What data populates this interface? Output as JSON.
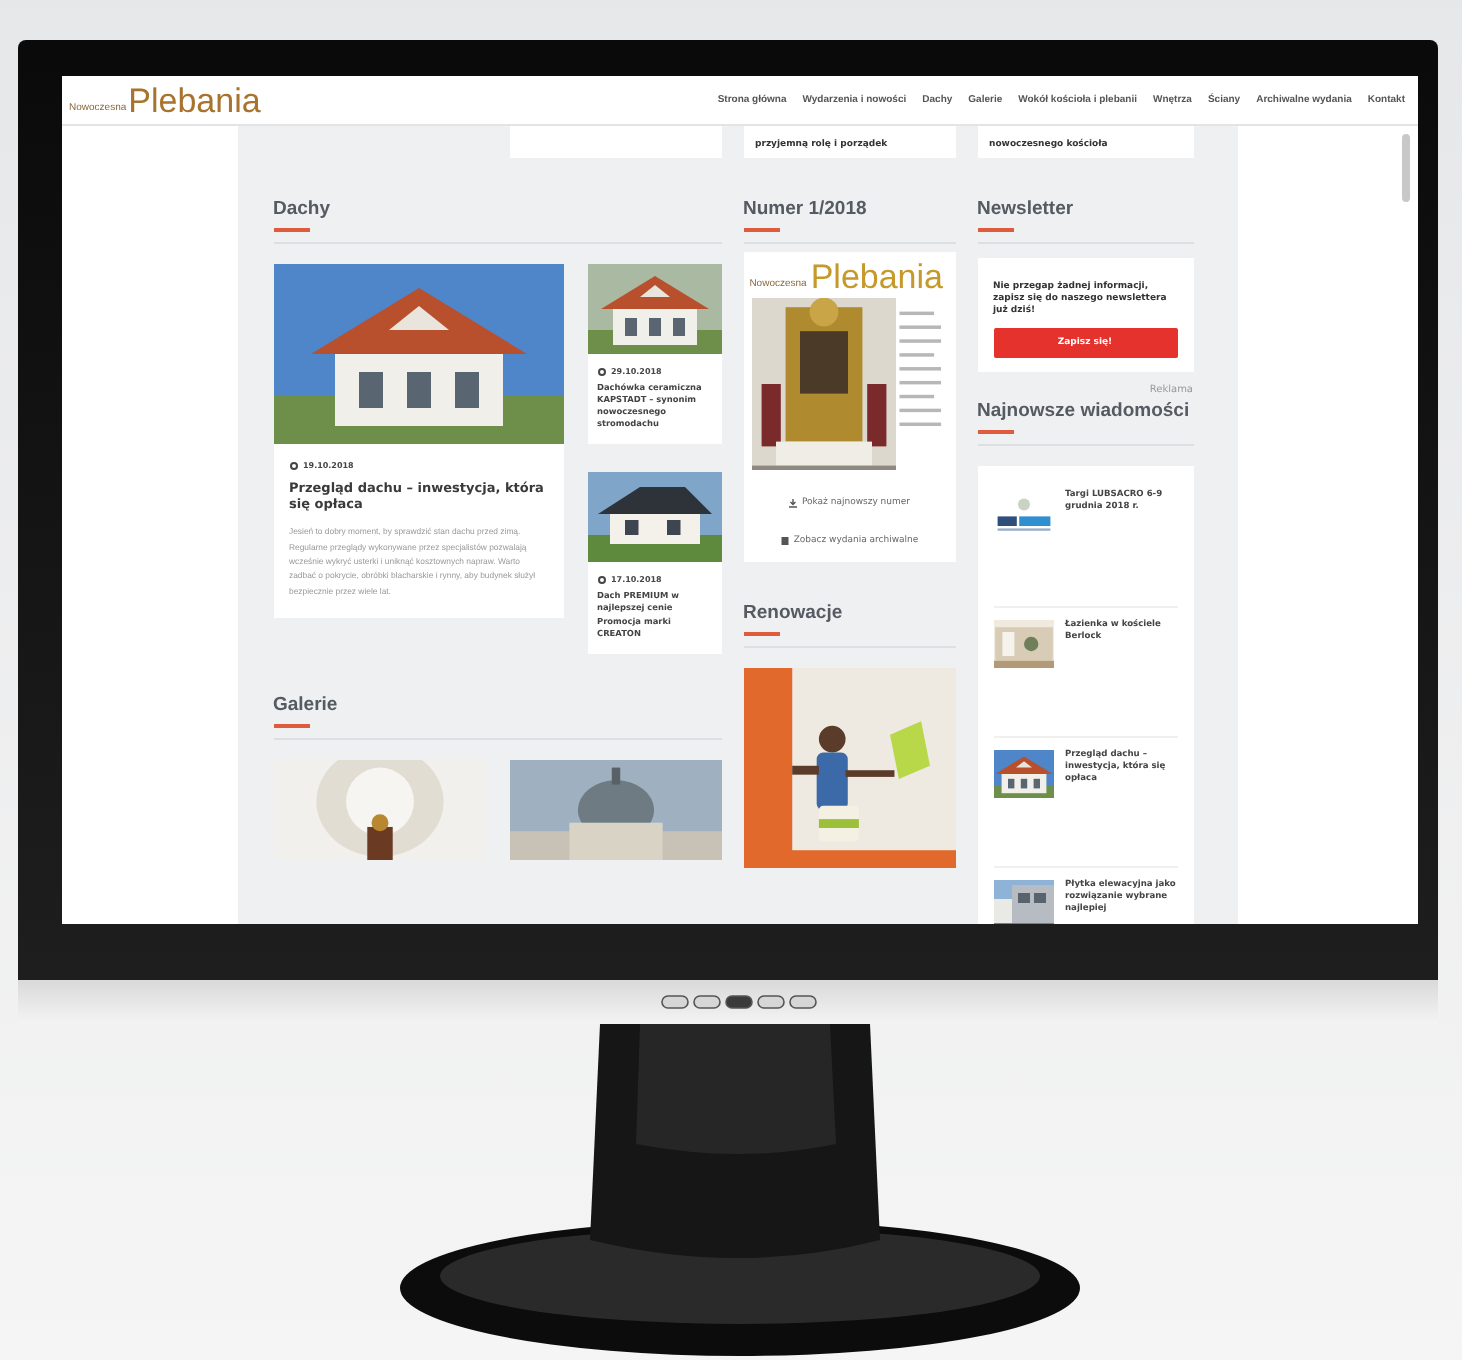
{
  "header": {
    "logo_tagline": "Nowoczesna",
    "logo": "Plebania"
  },
  "nav": [
    {
      "label": "Strona główna"
    },
    {
      "label": "Wydarzenia i nowości"
    },
    {
      "label": "Dachy"
    },
    {
      "label": "Galerie"
    },
    {
      "label": "Wokół kościoła i plebanii"
    },
    {
      "label": "Wnętrza"
    },
    {
      "label": "Ściany"
    },
    {
      "label": "Archiwalne wydania"
    },
    {
      "label": "Kontakt"
    }
  ],
  "top_cards": [
    {
      "kind": "blank"
    },
    {
      "kind": "text",
      "text": "przyjemną rolę i porządek"
    },
    {
      "kind": "text",
      "text": "nowoczesnego kościoła"
    }
  ],
  "dachy": {
    "heading": "Dachy",
    "featured": {
      "date": "19.10.2018",
      "title": "Przegląd dachu – inwestycja, która się opłaca",
      "excerpt": "Jesień to dobry moment, by sprawdzić stan dachu przed zimą. Regularne przeglądy wykonywane przez specjalistów pozwalają wcześnie wykryć usterki i uniknąć kosztownych napraw. Warto zadbać o pokrycie, obróbki blacharskie i rynny, aby budynek służył bezpiecznie przez wiele lat."
    },
    "items": [
      {
        "date": "29.10.2018",
        "title": "Dachówka ceramiczna KAPSTADT – synonim nowoczesnego stromodachu"
      },
      {
        "date": "17.10.2018",
        "title": "Dach PREMIUM w najlepszej cenie Promocja marki CREATON"
      }
    ]
  },
  "issue": {
    "heading": "Numer 1/2018",
    "cover_tagline": "Nowoczesna",
    "cover_logo": "Plebania",
    "links": [
      {
        "kind": "download",
        "label": "Pokaż najnowszy numer"
      },
      {
        "kind": "archive",
        "label": "Zobacz wydania archiwalne"
      }
    ]
  },
  "renowacje": {
    "heading": "Renowacje"
  },
  "galerie": {
    "heading": "Galerie"
  },
  "newsletter": {
    "heading": "Newsletter",
    "text": "Nie przegap żadnej informacji, zapisz się do naszego newslettera już dziś!",
    "button": "Zapisz się!"
  },
  "ad_label": "Reklama",
  "latest": {
    "heading": "Najnowsze wiadomości",
    "items": [
      {
        "title": "Targi LUBSACRO 6-9 grudnia 2018 r."
      },
      {
        "title": "Łazienka w kościele Berlock"
      },
      {
        "title": "Przegląd dachu – inwestycja, która się opłaca"
      },
      {
        "title": "Płytka elewacyjna jako rozwiązanie wybrane najlepiej"
      }
    ]
  }
}
